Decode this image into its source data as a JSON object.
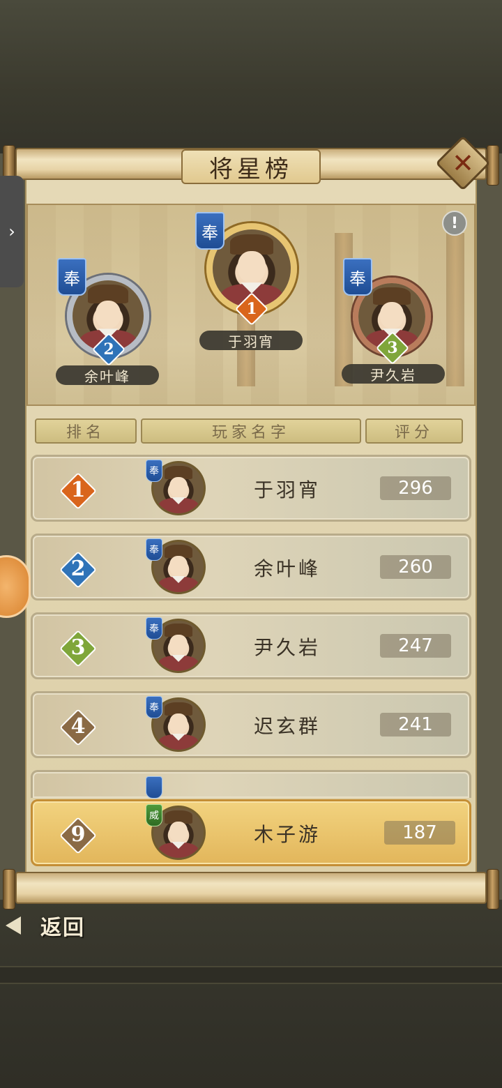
{
  "title": "将星榜",
  "buttons": {
    "close": "✕",
    "info": "!",
    "back": "返回",
    "side_tab": "›"
  },
  "podium": {
    "first": {
      "name": "于羽宵",
      "rank": "1",
      "badge": "奉"
    },
    "second": {
      "name": "余叶峰",
      "rank": "2",
      "badge": "奉"
    },
    "third": {
      "name": "尹久岩",
      "rank": "3",
      "badge": "奉"
    }
  },
  "headers": {
    "rank": "排名",
    "player_name": "玩家名字",
    "score": "评分"
  },
  "rows": [
    {
      "rank": "1",
      "name": "于羽宵",
      "score": "296",
      "badge": "奉"
    },
    {
      "rank": "2",
      "name": "余叶峰",
      "score": "260",
      "badge": "奉"
    },
    {
      "rank": "3",
      "name": "尹久岩",
      "score": "247",
      "badge": "奉"
    },
    {
      "rank": "4",
      "name": "迟玄群",
      "score": "241",
      "badge": "奉"
    }
  ],
  "my_row": {
    "rank": "9",
    "name": "木子游",
    "score": "187",
    "badge": "威"
  },
  "colors": {
    "gold": "#e7c572",
    "silver": "#b7bcc4",
    "bronze": "#b97c5c",
    "rank1": "#d9651c",
    "rank2": "#2f73b8",
    "rank3": "#7fa63a",
    "rank_other": "#8a6a45",
    "highlight": "#f2d37f"
  },
  "icons": {
    "close": "close-icon",
    "info": "info-icon",
    "back": "back-arrow-icon",
    "faction": "faction-flag-icon",
    "rank": "rank-diamond-icon"
  }
}
